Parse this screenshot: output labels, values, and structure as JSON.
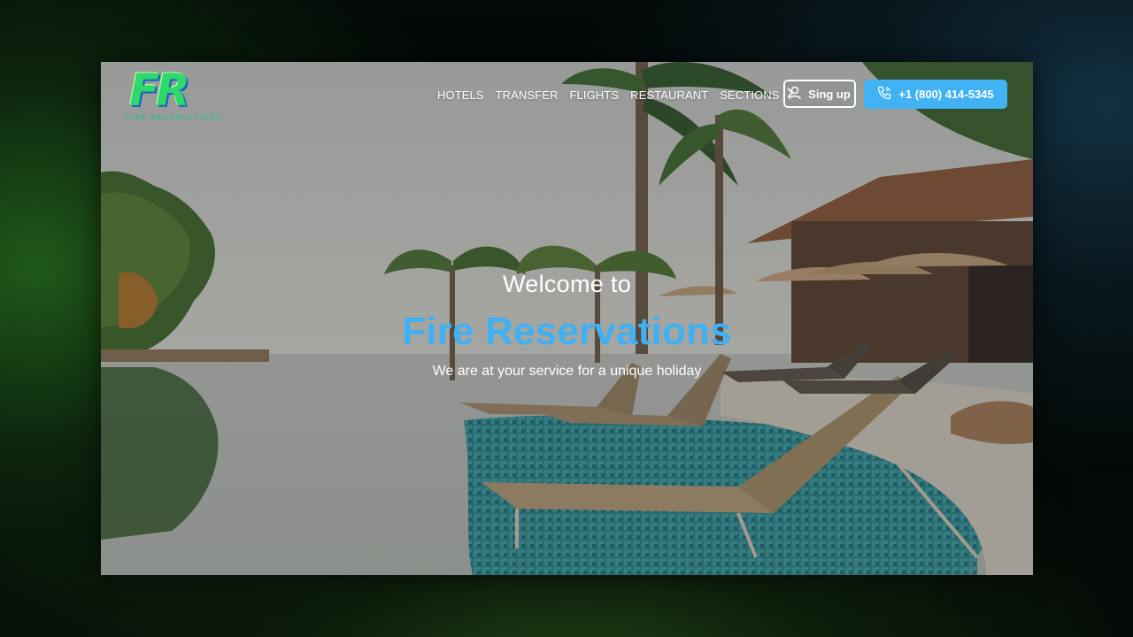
{
  "brand": {
    "logo_letters": "FR",
    "logo_subtitle": "FIRE RESERVATIONS"
  },
  "nav": {
    "items": [
      "HOTELS",
      "TRANSFER",
      "FLIGHTS",
      "RESTAURANT",
      "SECTIONS"
    ],
    "more_icon": "chevron-right-icon"
  },
  "actions": {
    "signup_label": "Sing up",
    "signup_icon": "user-icon",
    "phone_label": "+1 (800) 414-5345",
    "phone_icon": "phone-icon"
  },
  "hero": {
    "welcome": "Welcome to",
    "title": "Fire Reservations",
    "tagline": "We are at your service for a unique holiday"
  },
  "colors": {
    "accent": "#41b3f5",
    "title": "#3fb0f3",
    "logo_green": "#2fd86a"
  }
}
